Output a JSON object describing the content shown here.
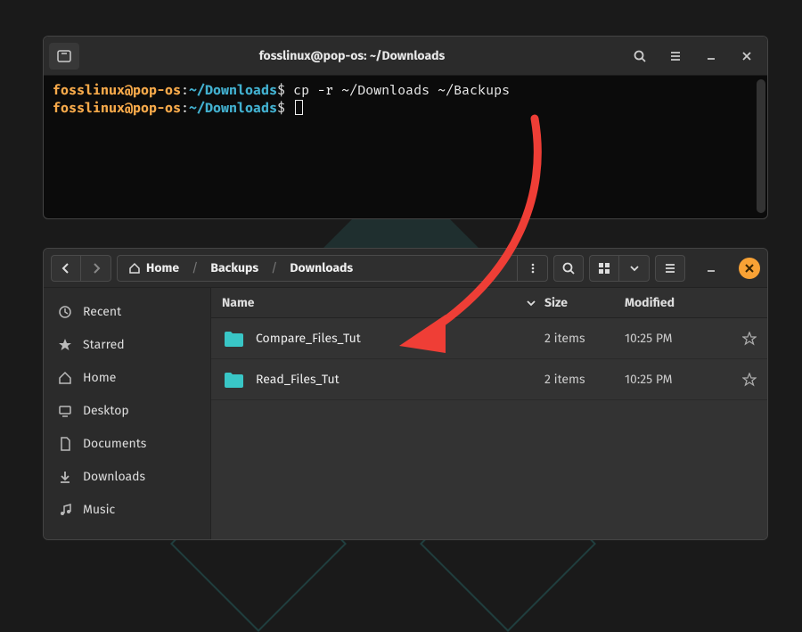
{
  "terminal": {
    "title": "fosslinux@pop-os: ~/Downloads",
    "lines": [
      {
        "user": "fosslinux@pop-os",
        "path": "~/Downloads",
        "cmd": "cp -r ~/Downloads ~/Backups"
      },
      {
        "user": "fosslinux@pop-os",
        "path": "~/Downloads",
        "cmd": ""
      }
    ]
  },
  "fm": {
    "breadcrumb": {
      "root": "Home",
      "seg1": "Backups",
      "seg2": "Downloads"
    },
    "columns": {
      "name": "Name",
      "size": "Size",
      "modified": "Modified"
    },
    "sidebar": [
      {
        "icon": "clock",
        "label": "Recent"
      },
      {
        "icon": "star",
        "label": "Starred"
      },
      {
        "icon": "home",
        "label": "Home"
      },
      {
        "icon": "desktop",
        "label": "Desktop"
      },
      {
        "icon": "doc",
        "label": "Documents"
      },
      {
        "icon": "download",
        "label": "Downloads"
      },
      {
        "icon": "music",
        "label": "Music"
      }
    ],
    "rows": [
      {
        "name": "Compare_Files_Tut",
        "size": "2 items",
        "modified": "10:25 PM"
      },
      {
        "name": "Read_Files_Tut",
        "size": "2 items",
        "modified": "10:25 PM"
      }
    ]
  },
  "colors": {
    "folder": "#39c6c6",
    "arrow": "#ef3e36"
  }
}
